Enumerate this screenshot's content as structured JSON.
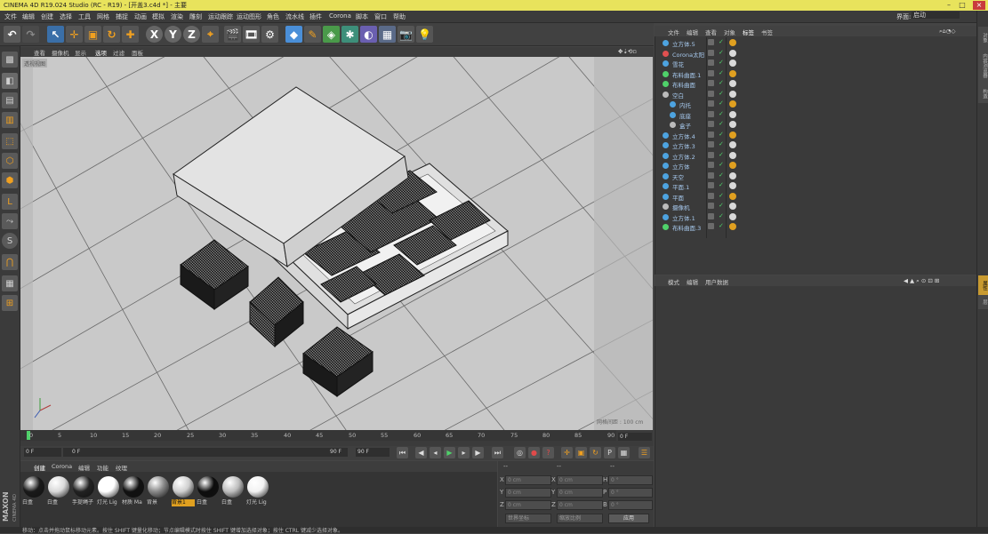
{
  "window": {
    "title": "CINEMA 4D R19.024 Studio (RC - R19) - [开盖3.c4d *] - 主要"
  },
  "menu": {
    "items": [
      "文件",
      "编辑",
      "创建",
      "选择",
      "工具",
      "网格",
      "捕捉",
      "动画",
      "模拟",
      "渲染",
      "雕刻",
      "运动跟踪",
      "运动图形",
      "角色",
      "流水线",
      "插件",
      "Corona",
      "脚本",
      "窗口",
      "帮助"
    ],
    "layout_label": "界面:",
    "layout_value": "启动"
  },
  "viewport": {
    "menu": [
      "查看",
      "摄像机",
      "显示",
      "选项",
      "过滤",
      "面板"
    ],
    "label": "透视视图",
    "grid_spacing": "网格间距 : 100 cm"
  },
  "timeline": {
    "ticks": [
      "0",
      "5",
      "10",
      "15",
      "20",
      "25",
      "30",
      "35",
      "40",
      "45",
      "50",
      "55",
      "60",
      "65",
      "70",
      "75",
      "80",
      "85",
      "90"
    ],
    "current_frame": "0 F",
    "start": "0 F",
    "slider_start": "0 F",
    "slider_end": "90 F",
    "end": "90 F"
  },
  "materials": {
    "menu": [
      "创建",
      "Corona",
      "编辑",
      "功能",
      "纹理"
    ],
    "items": [
      {
        "label": "白盒",
        "color": "#1a1a1a"
      },
      {
        "label": "白盒",
        "color": "#d9d9d9"
      },
      {
        "label": "手提绳子",
        "color": "#222222"
      },
      {
        "label": "灯光 Lig",
        "color": "#ffffff"
      },
      {
        "label": "材质 Ma",
        "color": "#111111"
      },
      {
        "label": "背景",
        "color": "#888888"
      },
      {
        "label": "背景1",
        "color": "#cfcfcf"
      },
      {
        "label": "白盒",
        "color": "#0d0d0d"
      },
      {
        "label": "白盒",
        "color": "#bdbdbd"
      },
      {
        "label": "灯光 Lig",
        "color": "#f2f2f2"
      }
    ],
    "selected_index": 6
  },
  "coords": {
    "header": [
      "--",
      "--",
      "--"
    ],
    "rows": [
      {
        "axis": "X",
        "pos": "0 cm",
        "axis2": "X",
        "size": "0 cm",
        "axis3": "H",
        "rot": "0 °"
      },
      {
        "axis": "Y",
        "pos": "0 cm",
        "axis2": "Y",
        "size": "0 cm",
        "axis3": "P",
        "rot": "0 °"
      },
      {
        "axis": "Z",
        "pos": "0 cm",
        "axis2": "Z",
        "size": "0 cm",
        "axis3": "B",
        "rot": "0 °"
      }
    ],
    "mode1": "世界坐标",
    "mode2": "缩放比例",
    "apply": "应用"
  },
  "objects": {
    "tabs": [
      "文件",
      "编辑",
      "查看",
      "对象",
      "标签",
      "书签"
    ],
    "active_tab": "标签",
    "rows": [
      {
        "name": "立方体.5",
        "indent": 0,
        "icon": "#4da3e0"
      },
      {
        "name": "Corona太阳",
        "indent": 0,
        "icon": "#e05050"
      },
      {
        "name": "雪花",
        "indent": 0,
        "icon": "#4da3e0"
      },
      {
        "name": "布料曲面.1",
        "indent": 0,
        "icon": "#4fd16a"
      },
      {
        "name": "布料曲面",
        "indent": 0,
        "icon": "#4fd16a"
      },
      {
        "name": "空白",
        "indent": 0,
        "icon": "#bbbbbb"
      },
      {
        "name": "内托",
        "indent": 1,
        "icon": "#4da3e0"
      },
      {
        "name": "底座",
        "indent": 1,
        "icon": "#4da3e0"
      },
      {
        "name": "盒子",
        "indent": 1,
        "icon": "#bbbbbb"
      },
      {
        "name": "立方体.4",
        "indent": 0,
        "icon": "#4da3e0"
      },
      {
        "name": "立方体.3",
        "indent": 0,
        "icon": "#4da3e0"
      },
      {
        "name": "立方体.2",
        "indent": 0,
        "icon": "#4da3e0"
      },
      {
        "name": "立方体",
        "indent": 0,
        "icon": "#4da3e0"
      },
      {
        "name": "天空",
        "indent": 0,
        "icon": "#4da3e0"
      },
      {
        "name": "平面.1",
        "indent": 0,
        "icon": "#4da3e0"
      },
      {
        "name": "平面",
        "indent": 0,
        "icon": "#4da3e0"
      },
      {
        "name": "摄像机",
        "indent": 0,
        "icon": "#bbbbbb"
      },
      {
        "name": "立方体.1",
        "indent": 0,
        "icon": "#4da3e0"
      },
      {
        "name": "布料曲面.3",
        "indent": 0,
        "icon": "#4fd16a"
      }
    ]
  },
  "attributes": {
    "tabs": [
      "模式",
      "编辑",
      "用户数据"
    ]
  },
  "right_strip": [
    "对象",
    "内容浏览器",
    "构造",
    "属性",
    "层"
  ],
  "status": {
    "text": "移动：点击并拖动鼠标移动元素。按住 SHIFT 键量化移动；节点编辑模式时按住 SHIFT 键增加选择对象；按住 CTRL 键减少选择对象。"
  },
  "brand": {
    "line1": "MAXON",
    "line2": "CINEMA 4D"
  }
}
